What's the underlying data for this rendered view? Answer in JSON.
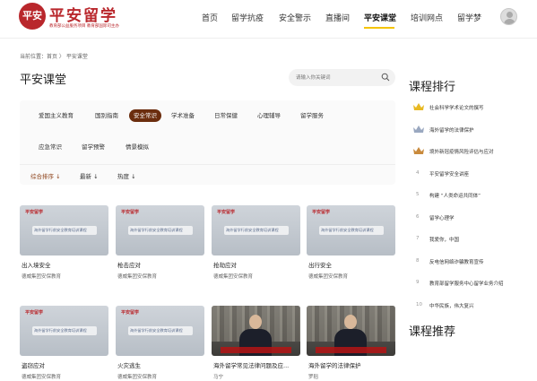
{
  "header": {
    "logo_seal": "平安",
    "logo_title": "平安留学",
    "logo_subtitle": "教育部公益服务项目  教育部国际司主办",
    "nav": [
      {
        "label": "首页",
        "active": false
      },
      {
        "label": "留学抗疫",
        "active": false
      },
      {
        "label": "安全警示",
        "active": false
      },
      {
        "label": "直播间",
        "active": false
      },
      {
        "label": "平安课堂",
        "active": true
      },
      {
        "label": "培训网点",
        "active": false
      },
      {
        "label": "留学梦",
        "active": false
      }
    ]
  },
  "breadcrumb": "当前位置：首页 〉 平安课堂",
  "page_title": "平安课堂",
  "search": {
    "placeholder": "请输入你关键词"
  },
  "filters": {
    "row1": [
      {
        "label": "爱国主义教育",
        "active": false
      },
      {
        "label": "国别指南",
        "active": false
      },
      {
        "label": "安全常识",
        "active": true
      },
      {
        "label": "学术准备",
        "active": false
      },
      {
        "label": "日常保健",
        "active": false
      },
      {
        "label": "心理辅导",
        "active": false
      },
      {
        "label": "留学服务",
        "active": false
      }
    ],
    "row2": [
      {
        "label": "应急常识",
        "active": false
      },
      {
        "label": "留学预警",
        "active": false
      },
      {
        "label": "情景模拟",
        "active": false
      }
    ]
  },
  "sorts": [
    {
      "label": "综合排序 ↓",
      "active": true
    },
    {
      "label": "最新 ↓",
      "active": false
    },
    {
      "label": "热度 ↓",
      "active": false
    }
  ],
  "cards": [
    {
      "title": "出入境安全",
      "org": "德威集团安保教育",
      "thumb": "slide",
      "thumb_logo": "平安留学",
      "thumb_text": "海外留学行前安全教育培训课程"
    },
    {
      "title": "枪击应对",
      "org": "德威集团安保教育",
      "thumb": "slide",
      "thumb_logo": "平安留学",
      "thumb_text": "海外留学行前安全教育培训课程"
    },
    {
      "title": "抢劫应对",
      "org": "德威集团安保教育",
      "thumb": "slide",
      "thumb_logo": "平安留学",
      "thumb_text": "海外留学行前安全教育培训课程"
    },
    {
      "title": "出行安全",
      "org": "德威集团安保教育",
      "thumb": "slide",
      "thumb_logo": "平安留学",
      "thumb_text": "海外留学行前安全教育培训课程"
    },
    {
      "title": "盗窃应对",
      "org": "德威集团安保教育",
      "thumb": "slide",
      "thumb_logo": "平安留学",
      "thumb_text": "海外留学行前安全教育培训课程"
    },
    {
      "title": "火灾逃生",
      "org": "德威集团安保教育",
      "thumb": "slide",
      "thumb_logo": "平安留学",
      "thumb_text": "海外留学行前安全教育培训课程"
    },
    {
      "title": "海外留学常见法律问题及应...",
      "org": "马宁",
      "thumb": "video",
      "thumb_logo": "",
      "thumb_text": ""
    },
    {
      "title": "海外留学的法律保护",
      "org": "罗稻",
      "thumb": "video",
      "thumb_logo": "",
      "thumb_text": ""
    }
  ],
  "ranking": {
    "title": "课程排行",
    "items": [
      {
        "num": "",
        "label": "社会科学学术论文的撰写",
        "crown": "gold"
      },
      {
        "num": "",
        "label": "海外留学的法律保护",
        "crown": "silver"
      },
      {
        "num": "",
        "label": "境外新冠疫情风险评估与应对",
        "crown": "bronze"
      },
      {
        "num": "4",
        "label": "平安留学安全讲座",
        "crown": ""
      },
      {
        "num": "5",
        "label": "构建 “人类命运共同体”",
        "crown": ""
      },
      {
        "num": "6",
        "label": "留学心理学",
        "crown": ""
      },
      {
        "num": "7",
        "label": "我爱你，中国",
        "crown": ""
      },
      {
        "num": "8",
        "label": "反电信网络诈骗教育宣传",
        "crown": ""
      },
      {
        "num": "9",
        "label": "教育部留学服务中心留学业务介绍",
        "crown": ""
      },
      {
        "num": "10",
        "label": "中华民族，伟大复兴",
        "crown": ""
      }
    ]
  },
  "recommend_title": "课程推荐",
  "colors": {
    "brand_red": "#b9272c",
    "active_tag": "#6b2d0e",
    "nav_underline": "#f5c400",
    "gold": "#e8b923",
    "silver": "#9aa8c0",
    "bronze": "#c98a3c"
  }
}
